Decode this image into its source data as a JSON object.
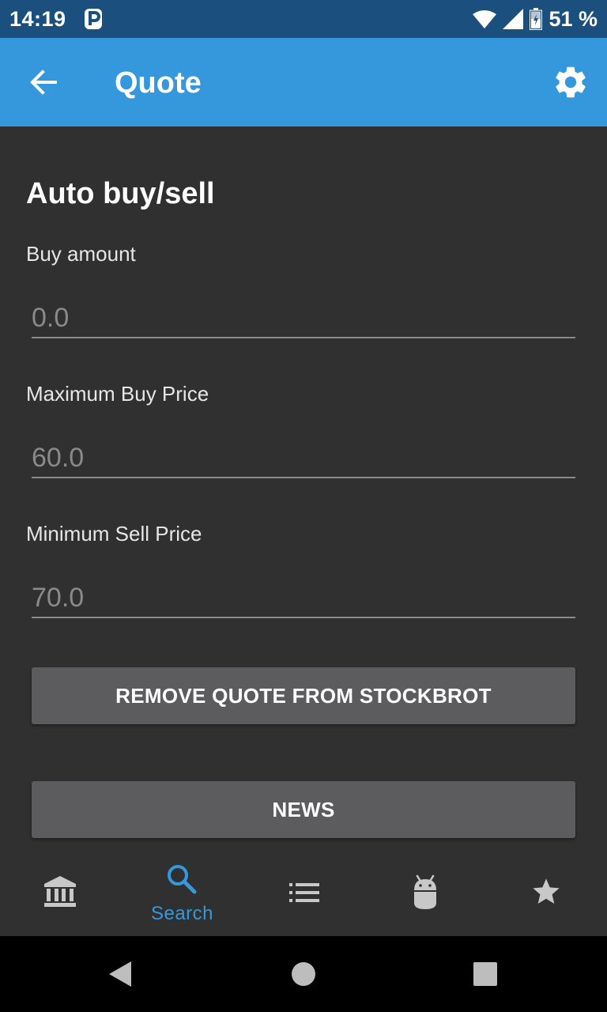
{
  "status_bar": {
    "time": "14:19",
    "battery_text": "51 %",
    "icons": [
      "parking-icon",
      "wifi-icon",
      "signal-icon",
      "battery-icon"
    ]
  },
  "app_bar": {
    "title": "Quote",
    "background": "#3598dc",
    "icons": [
      "back-arrow-icon",
      "gear-icon"
    ]
  },
  "section": {
    "title": "Auto buy/sell"
  },
  "fields": [
    {
      "label": "Buy amount",
      "placeholder": "0.0"
    },
    {
      "label": "Maximum Buy Price",
      "placeholder": "60.0"
    },
    {
      "label": "Minimum Sell Price",
      "placeholder": "70.0"
    }
  ],
  "buttons": {
    "remove": "REMOVE QUOTE FROM STOCKBROT",
    "news": "NEWS"
  },
  "bottom_nav": {
    "items": [
      {
        "icon": "bank-icon",
        "label": ""
      },
      {
        "icon": "search-icon",
        "label": "Search",
        "active": true
      },
      {
        "icon": "list-icon",
        "label": ""
      },
      {
        "icon": "android-icon",
        "label": ""
      },
      {
        "icon": "star-icon",
        "label": ""
      }
    ],
    "active_color": "#3598dc"
  },
  "system_nav": {
    "icons": [
      "back-triangle-icon",
      "home-circle-icon",
      "recents-square-icon"
    ]
  }
}
